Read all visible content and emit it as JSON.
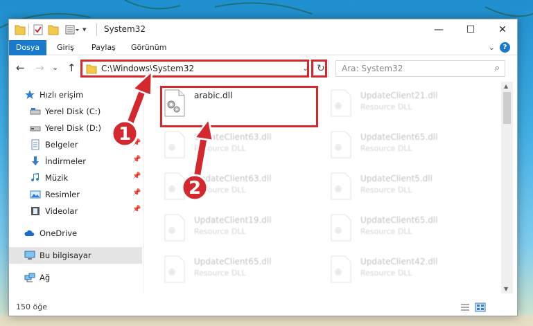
{
  "window": {
    "title": "System32",
    "quick_access_icons": [
      "folder-icon",
      "properties-check-icon",
      "new-folder-icon",
      "customize-list-icon"
    ],
    "controls": {
      "minimize": "—",
      "maximize": "☐",
      "close": "✕"
    }
  },
  "ribbon": {
    "tabs": [
      {
        "label": "Dosya",
        "active": true
      },
      {
        "label": "Giriş"
      },
      {
        "label": "Paylaş"
      },
      {
        "label": "Görünüm"
      }
    ],
    "help_label": "?"
  },
  "navigation": {
    "back": "←",
    "forward": "→",
    "recent": "⌄",
    "up": "↑",
    "address": "C:\\Windows\\System32",
    "refresh": "↻",
    "search_placeholder": "Ara: System32"
  },
  "sidebar": {
    "items": [
      {
        "label": "Hızlı erişim",
        "icon": "star-icon"
      },
      {
        "label": "Yerel Disk (C:)",
        "icon": "drive-icon"
      },
      {
        "label": "Yerel Disk (D:)",
        "icon": "drive-icon"
      },
      {
        "label": "Belgeler",
        "icon": "documents-icon",
        "pinned": true
      },
      {
        "label": "İndirmeler",
        "icon": "download-icon",
        "pinned": true
      },
      {
        "label": "Müzik",
        "icon": "music-icon",
        "pinned": true
      },
      {
        "label": "Resimler",
        "icon": "pictures-icon",
        "pinned": true
      },
      {
        "label": "Videolar",
        "icon": "videos-icon",
        "pinned": true
      },
      {
        "label": "OneDrive",
        "icon": "cloud-icon"
      },
      {
        "label": "Bu bilgisayar",
        "icon": "computer-icon",
        "selected": true
      },
      {
        "label": "Ağ",
        "icon": "network-icon"
      }
    ]
  },
  "files": {
    "left": [
      {
        "name": "arabic.dll",
        "type": ""
      },
      {
        "name": "UpdateClient63.dll",
        "type": "Resource DLL"
      },
      {
        "name": "UpdateClient63.dll",
        "type": "Resource DLL"
      },
      {
        "name": "UpdateClient19.dll",
        "type": "Resource DLL"
      },
      {
        "name": "UpdateClient65.dll",
        "type": "Resource DLL"
      }
    ],
    "right": [
      {
        "name": "UpdateClient21.dll",
        "type": "Resource DLL"
      },
      {
        "name": "UpdateClient65.dll",
        "type": "Resource DLL"
      },
      {
        "name": "UpdateClient5.dll",
        "type": "Resource DLL"
      },
      {
        "name": "UpdateClient65.dll",
        "type": "Resource DLL"
      },
      {
        "name": "UpdateClient42.dll",
        "type": "Resource DLL"
      }
    ]
  },
  "status": {
    "item_count": "150 öğe"
  },
  "annotations": {
    "step1": "1",
    "step2": "2",
    "color": "#d4282f"
  }
}
